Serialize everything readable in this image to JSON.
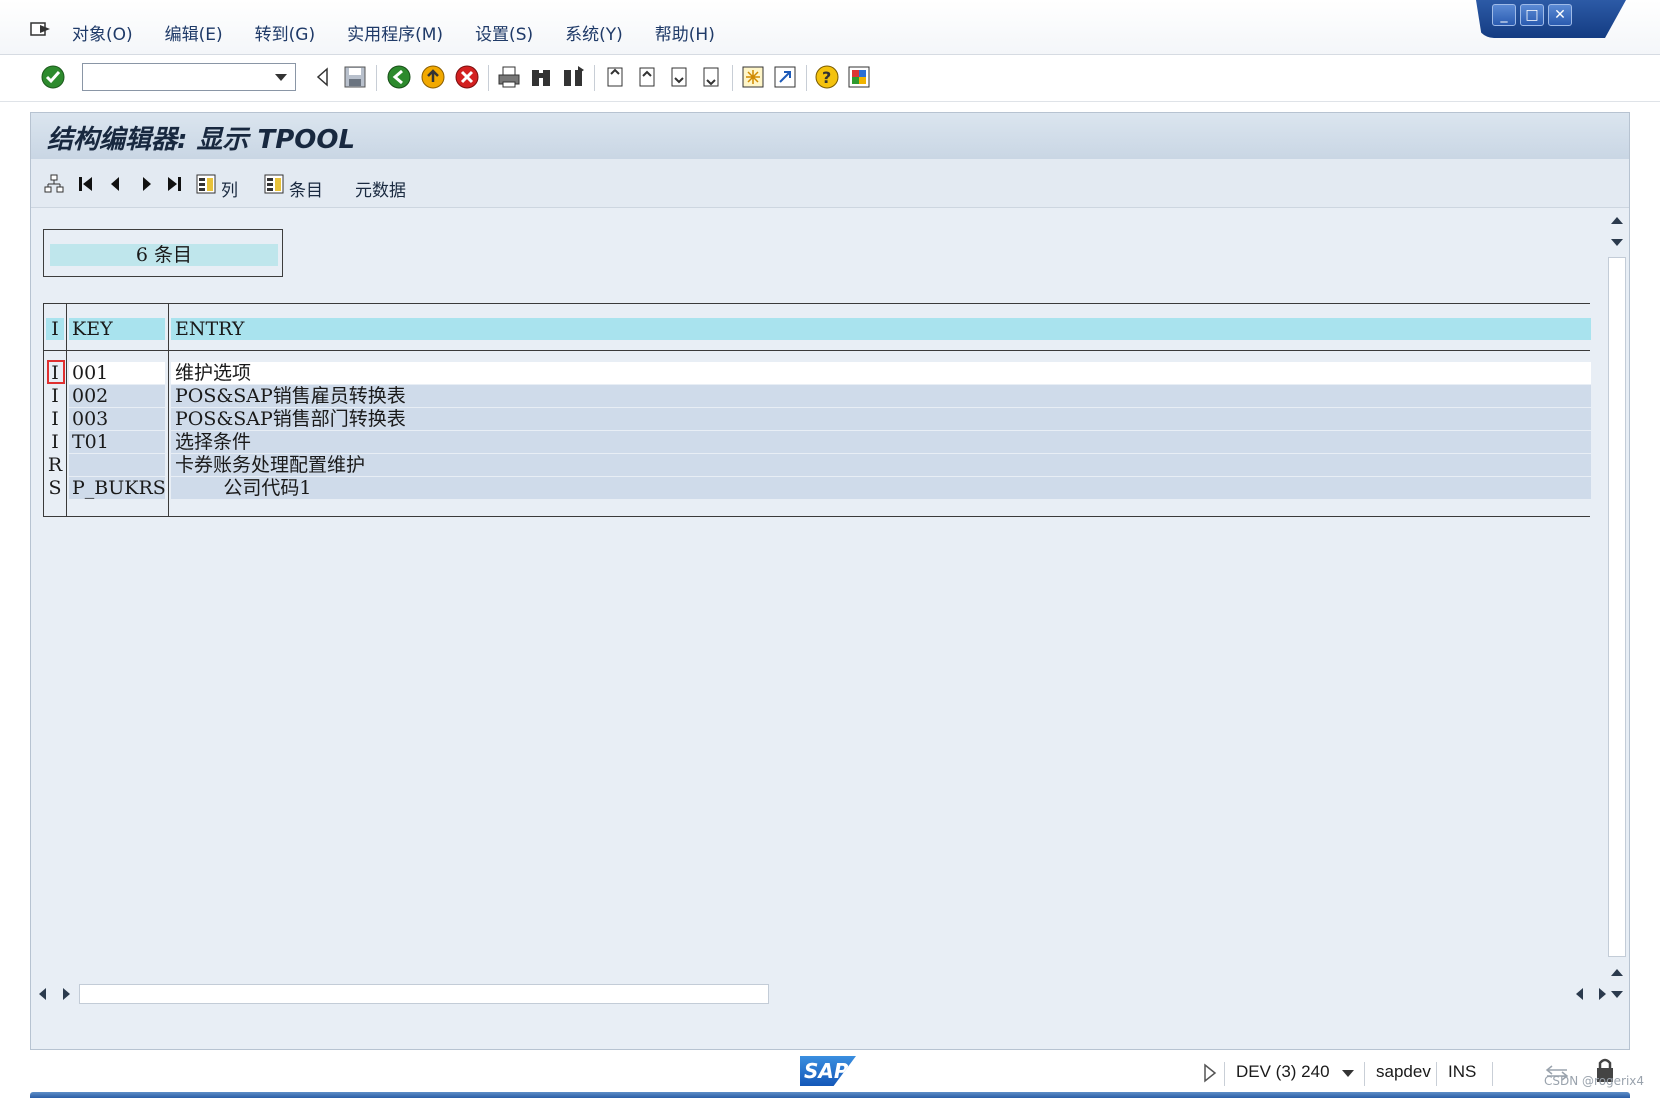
{
  "menu": {
    "items": [
      "对象(O)",
      "编辑(E)",
      "转到(G)",
      "实用程序(M)",
      "设置(S)",
      "系统(Y)",
      "帮助(H)"
    ]
  },
  "toolbar": {
    "command_field_value": ""
  },
  "window_controls": [
    "_",
    "□",
    "✕"
  ],
  "title": "结构编辑器: 显示 TPOOL",
  "app_toolbar": {
    "columns_label": "列",
    "entries_label": "条目",
    "metadata_label": "元数据"
  },
  "count_label": "6 条目",
  "table": {
    "headers": {
      "id": "I",
      "key": "KEY",
      "entry": "ENTRY"
    },
    "rows": [
      {
        "id": "I",
        "key": "001",
        "entry": "维护选项"
      },
      {
        "id": "I",
        "key": "002",
        "entry": "POS&SAP销售雇员转换表"
      },
      {
        "id": "I",
        "key": "003",
        "entry": "POS&SAP销售部门转换表"
      },
      {
        "id": "I",
        "key": "T01",
        "entry": "选择条件"
      },
      {
        "id": "R",
        "key": "",
        "entry": "卡券账务处理配置维护"
      },
      {
        "id": "S",
        "key": "P_BUKRS",
        "entry": "        公司代码1"
      }
    ]
  },
  "status": {
    "system": "DEV (3) 240",
    "server": "sapdev",
    "mode": "INS"
  },
  "watermark": "CSDN @rogerix4",
  "colors": {
    "header_cell": "#a9e3ee",
    "row_background": "#cfdbea",
    "frame_background": "#e8eef5"
  }
}
